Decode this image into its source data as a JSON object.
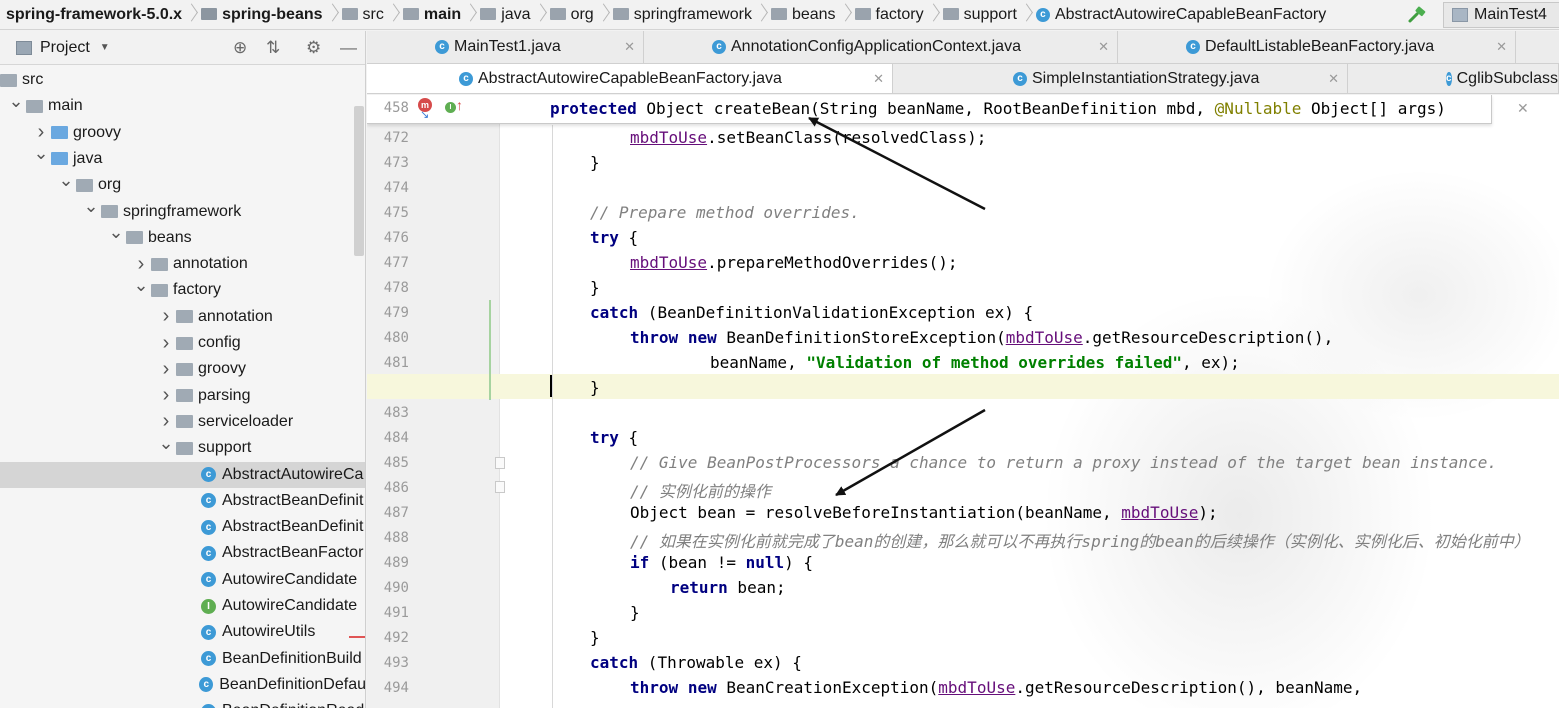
{
  "breadcrumb": [
    {
      "label": "spring-framework-5.0.x",
      "kind": "project",
      "bold": true
    },
    {
      "label": "spring-beans",
      "kind": "module",
      "bold": true
    },
    {
      "label": "src",
      "kind": "folder",
      "bold": false
    },
    {
      "label": "main",
      "kind": "folder",
      "bold": true
    },
    {
      "label": "java",
      "kind": "folder",
      "bold": false
    },
    {
      "label": "org",
      "kind": "folder",
      "bold": false
    },
    {
      "label": "springframework",
      "kind": "folder",
      "bold": false
    },
    {
      "label": "beans",
      "kind": "folder",
      "bold": false
    },
    {
      "label": "factory",
      "kind": "folder",
      "bold": false
    },
    {
      "label": "support",
      "kind": "folder",
      "bold": false
    },
    {
      "label": "AbstractAutowireCapableBeanFactory",
      "kind": "class",
      "bold": false
    }
  ],
  "toolbar": {
    "build_icon": "hammer-icon",
    "run_config_label": "MainTest4"
  },
  "project_panel": {
    "title": "Project",
    "icons": [
      "target-icon",
      "collapse-icon",
      "gear-icon",
      "minimize-icon"
    ]
  },
  "tree": [
    {
      "label": "src",
      "depth": 0,
      "expanded": null,
      "type": "folder"
    },
    {
      "label": "main",
      "depth": 1,
      "expanded": true,
      "type": "folder"
    },
    {
      "label": "groovy",
      "depth": 2,
      "expanded": false,
      "type": "src-folder"
    },
    {
      "label": "java",
      "depth": 2,
      "expanded": true,
      "type": "src-folder"
    },
    {
      "label": "org",
      "depth": 3,
      "expanded": true,
      "type": "package"
    },
    {
      "label": "springframework",
      "depth": 4,
      "expanded": true,
      "type": "package"
    },
    {
      "label": "beans",
      "depth": 5,
      "expanded": true,
      "type": "package"
    },
    {
      "label": "annotation",
      "depth": 6,
      "expanded": false,
      "type": "package"
    },
    {
      "label": "factory",
      "depth": 6,
      "expanded": true,
      "type": "package"
    },
    {
      "label": "annotation",
      "depth": 7,
      "expanded": false,
      "type": "package"
    },
    {
      "label": "config",
      "depth": 7,
      "expanded": false,
      "type": "package"
    },
    {
      "label": "groovy",
      "depth": 7,
      "expanded": false,
      "type": "package"
    },
    {
      "label": "parsing",
      "depth": 7,
      "expanded": false,
      "type": "package"
    },
    {
      "label": "serviceloader",
      "depth": 7,
      "expanded": false,
      "type": "package"
    },
    {
      "label": "support",
      "depth": 7,
      "expanded": true,
      "type": "package"
    },
    {
      "label": "AbstractAutowireCa",
      "depth": 8,
      "expanded": null,
      "type": "class",
      "selected": true
    },
    {
      "label": "AbstractBeanDefinit",
      "depth": 8,
      "expanded": null,
      "type": "class"
    },
    {
      "label": "AbstractBeanDefinit",
      "depth": 8,
      "expanded": null,
      "type": "class"
    },
    {
      "label": "AbstractBeanFactor",
      "depth": 8,
      "expanded": null,
      "type": "class"
    },
    {
      "label": "AutowireCandidate",
      "depth": 8,
      "expanded": null,
      "type": "class"
    },
    {
      "label": "AutowireCandidate",
      "depth": 8,
      "expanded": null,
      "type": "interface"
    },
    {
      "label": "AutowireUtils",
      "depth": 8,
      "expanded": null,
      "type": "class"
    },
    {
      "label": "BeanDefinitionBuild",
      "depth": 8,
      "expanded": null,
      "type": "class"
    },
    {
      "label": "BeanDefinitionDefau",
      "depth": 8,
      "expanded": null,
      "type": "class"
    },
    {
      "label": "BeanDefinitionRead",
      "depth": 8,
      "expanded": null,
      "type": "class"
    }
  ],
  "tabs_row1": [
    {
      "label": "MainTest1.java",
      "active": false
    },
    {
      "label": "AnnotationConfigApplicationContext.java",
      "active": false
    },
    {
      "label": "DefaultListableBeanFactory.java",
      "active": false
    }
  ],
  "tabs_row2": [
    {
      "label": "AbstractAutowireCapableBeanFactory.java",
      "active": true
    },
    {
      "label": "SimpleInstantiationStrategy.java",
      "active": false
    },
    {
      "label": "CglibSubclass",
      "active": false
    }
  ],
  "sticky_header": {
    "line": "458",
    "tokens": [
      {
        "t": "protected",
        "c": "kw"
      },
      {
        "t": " Object createBean(String beanName, RootBeanDefinition mbd, ",
        "c": ""
      },
      {
        "t": "@Nullable",
        "c": "an"
      },
      {
        "t": " Object[] args)",
        "c": ""
      }
    ]
  },
  "code_lines": [
    {
      "n": "472",
      "indent": 2,
      "tokens": [
        {
          "t": "mbdToUse",
          "c": "fv"
        },
        {
          "t": ".setBeanClass(resolvedClass);",
          "c": ""
        }
      ]
    },
    {
      "n": "473",
      "indent": 1,
      "tokens": [
        {
          "t": "}",
          "c": ""
        }
      ]
    },
    {
      "n": "474",
      "indent": 0,
      "tokens": []
    },
    {
      "n": "475",
      "indent": 1,
      "tokens": [
        {
          "t": "// Prepare method overrides.",
          "c": "cm"
        }
      ]
    },
    {
      "n": "476",
      "indent": 1,
      "tokens": [
        {
          "t": "try",
          "c": "kw"
        },
        {
          "t": " {",
          "c": ""
        }
      ]
    },
    {
      "n": "477",
      "indent": 2,
      "tokens": [
        {
          "t": "mbdToUse",
          "c": "fv"
        },
        {
          "t": ".prepareMethodOverrides();",
          "c": ""
        }
      ]
    },
    {
      "n": "478",
      "indent": 1,
      "tokens": [
        {
          "t": "}",
          "c": ""
        }
      ]
    },
    {
      "n": "479",
      "indent": 1,
      "tokens": [
        {
          "t": "catch",
          "c": "kw"
        },
        {
          "t": " (BeanDefinitionValidationException ex) {",
          "c": ""
        }
      ]
    },
    {
      "n": "480",
      "indent": 2,
      "tokens": [
        {
          "t": "throw",
          "c": "kw"
        },
        {
          "t": " ",
          "c": ""
        },
        {
          "t": "new",
          "c": "kw"
        },
        {
          "t": " BeanDefinitionStoreException(",
          "c": ""
        },
        {
          "t": "mbdToUse",
          "c": "fv"
        },
        {
          "t": ".getResourceDescription(),",
          "c": ""
        }
      ]
    },
    {
      "n": "481",
      "indent": 4,
      "tokens": [
        {
          "t": "beanName, ",
          "c": ""
        },
        {
          "t": "\"Validation of method overrides failed\"",
          "c": "st"
        },
        {
          "t": ", ex);",
          "c": ""
        }
      ]
    },
    {
      "n": "482",
      "indent": 1,
      "tokens": [
        {
          "t": "}",
          "c": ""
        }
      ]
    },
    {
      "n": "483",
      "indent": 0,
      "tokens": []
    },
    {
      "n": "484",
      "indent": 1,
      "tokens": [
        {
          "t": "try",
          "c": "kw"
        },
        {
          "t": " {",
          "c": ""
        }
      ]
    },
    {
      "n": "485",
      "indent": 2,
      "tokens": [
        {
          "t": "// Give BeanPostProcessors a chance to return a proxy instead of the target bean instance.",
          "c": "cm"
        }
      ]
    },
    {
      "n": "486",
      "indent": 2,
      "tokens": [
        {
          "t": "// 实例化前的操作",
          "c": "cm"
        }
      ]
    },
    {
      "n": "487",
      "indent": 2,
      "tokens": [
        {
          "t": "Object bean = resolveBeforeInstantiation(beanName, ",
          "c": ""
        },
        {
          "t": "mbdToUse",
          "c": "fv"
        },
        {
          "t": ");",
          "c": ""
        }
      ]
    },
    {
      "n": "488",
      "indent": 2,
      "tokens": [
        {
          "t": "// 如果在实例化前就完成了bean的创建，那么就可以不再执行spring的bean的后续操作（实例化、实例化后、初始化前中）",
          "c": "cm"
        }
      ]
    },
    {
      "n": "489",
      "indent": 2,
      "tokens": [
        {
          "t": "if",
          "c": "kw"
        },
        {
          "t": " (bean != ",
          "c": ""
        },
        {
          "t": "null",
          "c": "kw"
        },
        {
          "t": ") {",
          "c": ""
        }
      ]
    },
    {
      "n": "490",
      "indent": 3,
      "tokens": [
        {
          "t": "return",
          "c": "kw"
        },
        {
          "t": " bean;",
          "c": ""
        }
      ]
    },
    {
      "n": "491",
      "indent": 2,
      "tokens": [
        {
          "t": "}",
          "c": ""
        }
      ]
    },
    {
      "n": "492",
      "indent": 1,
      "tokens": [
        {
          "t": "}",
          "c": ""
        }
      ]
    },
    {
      "n": "493",
      "indent": 1,
      "tokens": [
        {
          "t": "catch",
          "c": "kw"
        },
        {
          "t": " (Throwable ex) {",
          "c": ""
        }
      ]
    },
    {
      "n": "494",
      "indent": 2,
      "tokens": [
        {
          "t": "throw",
          "c": "kw"
        },
        {
          "t": " ",
          "c": ""
        },
        {
          "t": "new",
          "c": "kw"
        },
        {
          "t": " BeanCreationException(",
          "c": ""
        },
        {
          "t": "mbdToUse",
          "c": "fv"
        },
        {
          "t": ".getResourceDescription(), beanName,",
          "c": ""
        }
      ]
    }
  ],
  "current_line": "482",
  "colors": {
    "keyword": "#000080",
    "comment": "#808080",
    "string": "#008000",
    "field": "#660e7a",
    "annotation": "#808000",
    "class_icon": "#3d9ad6",
    "interface_icon": "#5fae52",
    "arrow": "#111111"
  }
}
